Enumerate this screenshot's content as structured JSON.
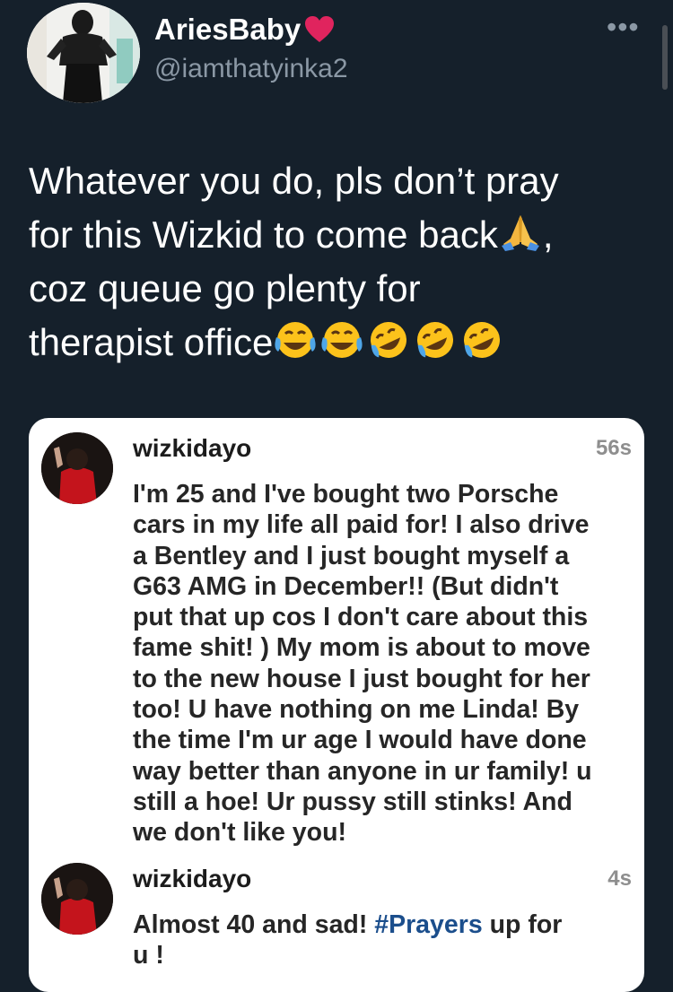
{
  "tweet": {
    "author": {
      "display_name": "AriesBaby",
      "handle": "@iamthatyinka2",
      "name_emoji": "red-heart"
    },
    "more_label": "•••",
    "text_lines": [
      "Whatever you do, pls don’t pray",
      "for this Wizkid to come back",
      ",",
      "coz queue go plenty for",
      "therapist office"
    ],
    "inline_emoji": [
      "folded-hands"
    ],
    "trailing_emoji": [
      "face-with-tears-of-joy",
      "face-with-tears-of-joy",
      "rolling-on-floor-laughing",
      "rolling-on-floor-laughing",
      "rolling-on-floor-laughing"
    ]
  },
  "embedded_screenshot": {
    "comments": [
      {
        "username": "wizkidayo",
        "time": "56s",
        "lines": [
          "I'm 25 and I've bought two Porsche",
          "cars in my life all paid for! I also drive",
          "a Bentley and I just bought myself a",
          "G63 AMG in December!! (But didn't",
          "put that up cos I don't care about this",
          "fame shit! ) My mom is about to move",
          "to the new house I just bought for her",
          "too! U have nothing on me Linda! By",
          "the time I'm ur age I would have done",
          "way better than anyone in ur family! u",
          "still a hoe! Ur pussy still stinks! And",
          "we don't like you!"
        ]
      },
      {
        "username": "wizkidayo",
        "time": "4s",
        "line1_before": "Almost 40 and sad! ",
        "hashtag": "#Prayers",
        "line1_after": " up for",
        "line2": "u !"
      }
    ]
  },
  "colors": {
    "background": "#15202b",
    "text": "#ffffff",
    "secondary": "#8b98a5",
    "heart": "#e0245e",
    "hashtag": "#1b4e8c"
  }
}
